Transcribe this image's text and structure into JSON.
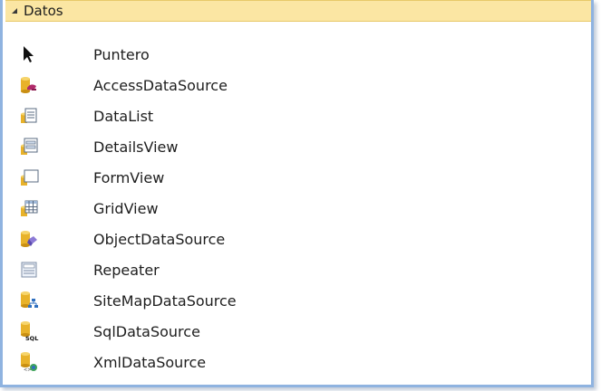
{
  "category": {
    "title": "Datos",
    "expanded_icon": "triangle-down-icon"
  },
  "items": [
    {
      "label": "Puntero",
      "icon": "pointer-arrow-icon"
    },
    {
      "label": "AccessDataSource",
      "icon": "access-datasource-icon"
    },
    {
      "label": "DataList",
      "icon": "datalist-icon"
    },
    {
      "label": "DetailsView",
      "icon": "detailsview-icon"
    },
    {
      "label": "FormView",
      "icon": "formview-icon"
    },
    {
      "label": "GridView",
      "icon": "gridview-icon"
    },
    {
      "label": "ObjectDataSource",
      "icon": "object-datasource-icon"
    },
    {
      "label": "Repeater",
      "icon": "repeater-icon"
    },
    {
      "label": "SiteMapDataSource",
      "icon": "sitemap-datasource-icon"
    },
    {
      "label": "SqlDataSource",
      "icon": "sql-datasource-icon"
    },
    {
      "label": "XmlDataSource",
      "icon": "xml-datasource-icon"
    }
  ],
  "colors": {
    "header_bg": "#fbe6a3",
    "frame_border": "#8fb3e0",
    "db_gold": "#e8b22a"
  }
}
